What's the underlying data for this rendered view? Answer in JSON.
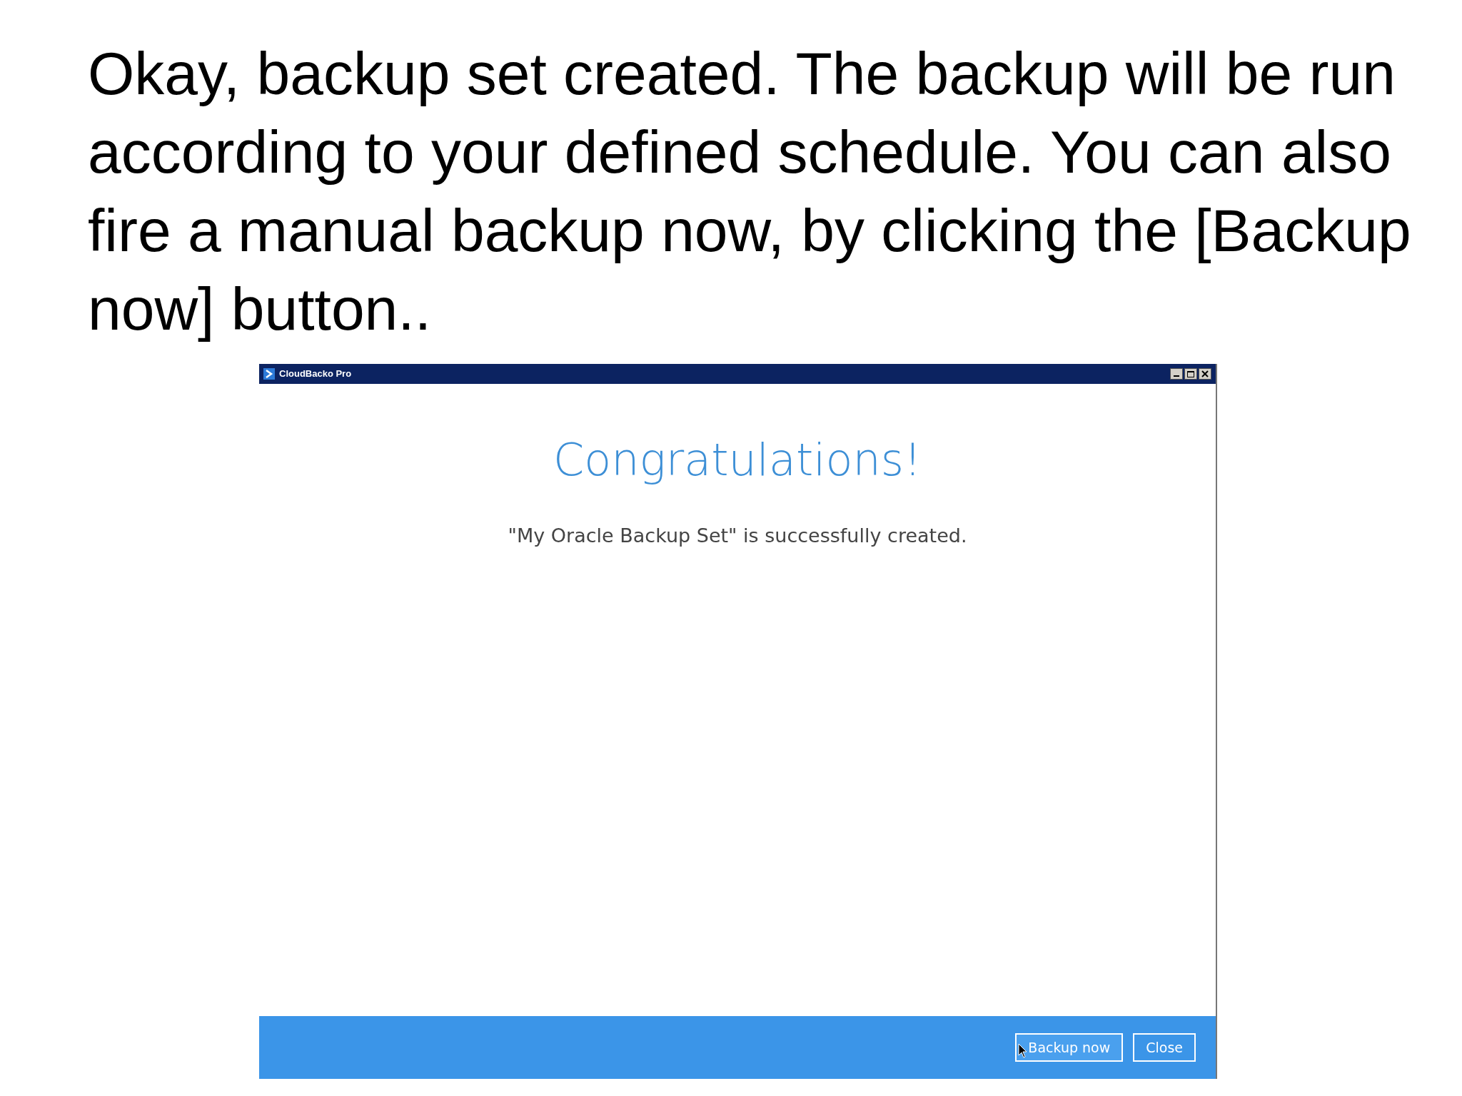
{
  "slide_text": "Okay, backup set created. The backup will be run according to your defined schedule. You can also fire a manual backup now, by clicking the [Backup now] button..",
  "window": {
    "title": "CloudBacko Pro",
    "heading": "Congratulations!",
    "message": "\"My Oracle Backup Set\" is successfully created.",
    "buttons": [
      {
        "label": "Backup now",
        "hovered": true
      },
      {
        "label": "Close",
        "hovered": false
      }
    ]
  }
}
